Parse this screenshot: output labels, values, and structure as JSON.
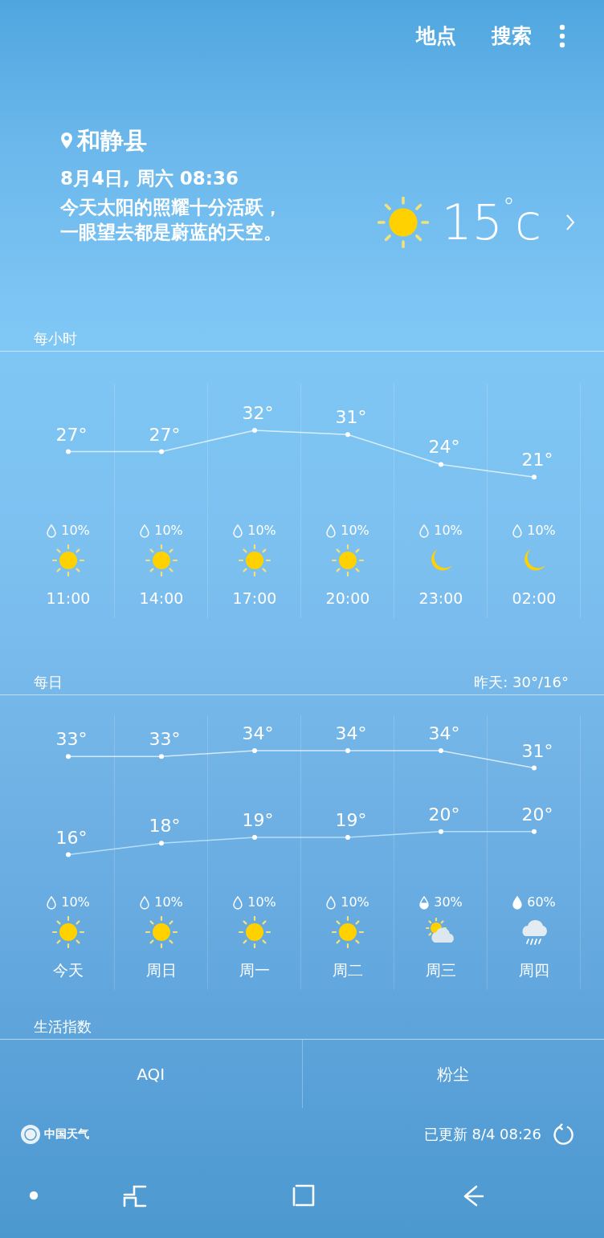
{
  "top_bar": {
    "actions": [
      "地点",
      "搜索"
    ]
  },
  "current": {
    "location": "和静县",
    "datetime": "8月4日, 周六 08:36",
    "description": "今天太阳的照耀十分活跃，一眼望去都是蔚蓝的天空。",
    "kind": "sun",
    "temperature": "15$^{°}$c"
  },
  "hourly": {
    "title": "每小时",
    "chart_data": {
      "type": "line",
      "categories": [
        "11:00",
        "14:00",
        "17:00",
        "20:00",
        "23:00",
        "02:00"
      ],
      "series": [
        {
          "marker": "circle",
          "values": [
            27,
            27,
            32,
            31,
            24,
            21
          ],
          "value_labels": [
            "27°",
            "27°",
            "32°",
            "31°",
            "24°",
            "21°"
          ]
        }
      ],
      "data_labels": true
    },
    "periods": [
      {
        "precipitation": "10%",
        "level": 0,
        "kind": "sun"
      },
      {
        "precipitation": "10%",
        "level": 0,
        "kind": "sun"
      },
      {
        "precipitation": "10%",
        "level": 0,
        "kind": "sun"
      },
      {
        "precipitation": "10%",
        "level": 0,
        "kind": "sun"
      },
      {
        "precipitation": "10%",
        "level": 0,
        "kind": "moon"
      },
      {
        "precipitation": "10%",
        "level": 0,
        "kind": "moon"
      }
    ]
  },
  "daily": {
    "title": "每日",
    "yesterday": "昨天: 30°/16°",
    "chart_data": {
      "type": "line",
      "categories": [
        "今天",
        "周日",
        "周一",
        "周二",
        "周三",
        "周四"
      ],
      "series": [
        {
          "marker": "circle",
          "values": [
            33,
            33,
            34,
            34,
            34,
            31
          ],
          "value_labels": [
            "33°",
            "33°",
            "34°",
            "34°",
            "34°",
            "31°"
          ]
        },
        {
          "marker": "circle",
          "values": [
            16,
            18,
            19,
            19,
            20,
            20
          ],
          "value_labels": [
            "16°",
            "18°",
            "19°",
            "19°",
            "20°",
            "20°"
          ]
        }
      ],
      "data_labels": true
    },
    "days": [
      {
        "precipitation": "10%",
        "level": 0,
        "kind": "sun"
      },
      {
        "precipitation": "10%",
        "level": 0,
        "kind": "sun"
      },
      {
        "precipitation": "10%",
        "level": 0,
        "kind": "sun"
      },
      {
        "precipitation": "10%",
        "level": 0,
        "kind": "sun"
      },
      {
        "precipitation": "30%",
        "level": 0.5,
        "kind": "sun-cloud"
      },
      {
        "precipitation": "60%",
        "level": 1,
        "kind": "rain-cloud"
      }
    ]
  },
  "life_index": {
    "title": "生活指数",
    "items": [
      "AQI",
      "粉尘"
    ]
  },
  "footer": {
    "logo": "中国天气",
    "updated": "已更新 8/4 08:26"
  }
}
